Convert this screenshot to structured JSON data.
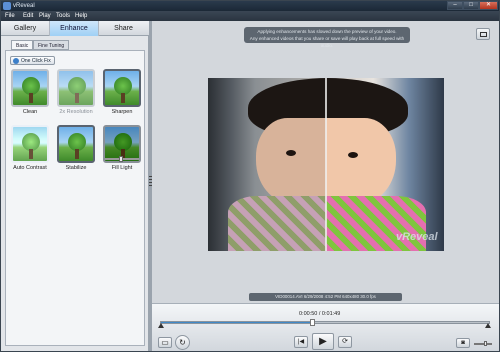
{
  "window": {
    "title": "vReveal"
  },
  "menu": [
    "File",
    "Edit",
    "Play",
    "Tools",
    "Help"
  ],
  "main_tabs": [
    "Gallery",
    "Enhance",
    "Share"
  ],
  "sub_tabs": [
    "Basic",
    "Fine Tuning"
  ],
  "one_click": "One Click Fix",
  "effects": [
    {
      "label": "Clean"
    },
    {
      "label": "2x Resolution"
    },
    {
      "label": "Sharpen"
    },
    {
      "label": "Auto Contrast"
    },
    {
      "label": "Stabilize"
    },
    {
      "label": "Fill Light"
    }
  ],
  "notice": {
    "line1": "Applying enhancements has slowed down the preview of your video.",
    "line2": "Any enhanced videos that you share or save will play back at full speed with audio."
  },
  "video": {
    "watermark": "vReveal",
    "info": "VID00014.AVI    6/29/2008  4:52 PM    640x480    30.0 fps"
  },
  "player": {
    "time": "0:00:50 / 0:01:49",
    "progress": 0.46,
    "volume": 0.6
  },
  "icons": {
    "play": "▶",
    "prev": "|◀",
    "repeat": "⟳",
    "rotate": "↻",
    "camera": "camera-icon"
  }
}
